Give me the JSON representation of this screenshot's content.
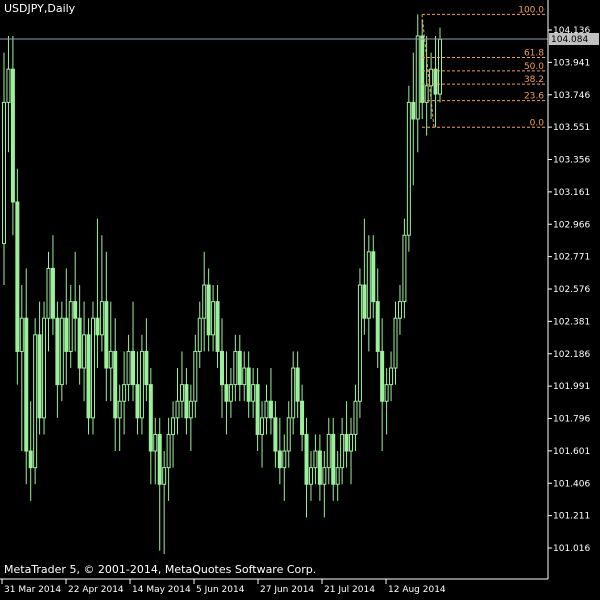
{
  "window": {
    "symbol_label": "USDJPY,Daily",
    "copyright": "MetaTrader 5, © 2001-2014, MetaQuotes Software Corp."
  },
  "price_axis": {
    "ticks": [
      "104.136",
      "103.941",
      "103.746",
      "103.551",
      "103.356",
      "103.161",
      "102.966",
      "102.771",
      "102.576",
      "102.381",
      "102.186",
      "101.991",
      "101.796",
      "101.601",
      "101.406",
      "101.211",
      "101.016"
    ],
    "current_price": "104.084"
  },
  "time_axis": {
    "labels": [
      "31 Mar 2014",
      "22 Apr 2014",
      "14 May 2014",
      "5 Jun 2014",
      "27 Jun 2014",
      "21 Jul 2014",
      "12 Aug 2014"
    ]
  },
  "fibonacci": {
    "levels": [
      "100.0",
      "61.8",
      "50.0",
      "38.2",
      "23.6",
      "0.0"
    ]
  },
  "colors": {
    "background": "#000000",
    "candle": "#9cf09c",
    "grid_line": "#ffffff",
    "fibo": "#f0a050",
    "current_price_line": "#8aa0b8",
    "current_price_badge": "#c0c0c0"
  },
  "chart_data": {
    "type": "candlestick",
    "symbol": "USDJPY",
    "timeframe": "Daily",
    "ylim": [
      101.016,
      104.136
    ],
    "y_ticks": [
      104.136,
      103.941,
      103.746,
      103.551,
      103.356,
      103.161,
      102.966,
      102.771,
      102.576,
      102.381,
      102.186,
      101.991,
      101.796,
      101.601,
      101.406,
      101.211,
      101.016
    ],
    "x_ticks": [
      "31 Mar 2014",
      "22 Apr 2014",
      "14 May 2014",
      "5 Jun 2014",
      "27 Jun 2014",
      "21 Jul 2014",
      "12 Aug 2014"
    ],
    "current_price": 104.084,
    "fibonacci_retracement": {
      "levels": [
        100.0,
        61.8,
        50.0,
        38.2,
        23.6,
        0.0
      ],
      "high_price": 104.23,
      "low_price": 103.55
    },
    "ohlc": [
      [
        102.85,
        104.0,
        102.6,
        103.7
      ],
      [
        103.7,
        104.1,
        103.4,
        103.9
      ],
      [
        103.9,
        104.1,
        102.9,
        103.1
      ],
      [
        103.1,
        103.3,
        102.0,
        102.2
      ],
      [
        102.2,
        102.6,
        101.6,
        102.4
      ],
      [
        102.4,
        102.7,
        101.4,
        101.6
      ],
      [
        101.6,
        101.9,
        101.3,
        101.5
      ],
      [
        101.5,
        102.4,
        101.4,
        102.3
      ],
      [
        102.3,
        102.5,
        101.7,
        101.8
      ],
      [
        101.8,
        102.5,
        101.7,
        102.4
      ],
      [
        102.4,
        102.8,
        102.2,
        102.7
      ],
      [
        102.7,
        102.9,
        102.3,
        102.4
      ],
      [
        102.4,
        102.5,
        101.8,
        102.0
      ],
      [
        102.0,
        102.5,
        101.9,
        102.4
      ],
      [
        102.4,
        102.7,
        102.0,
        102.2
      ],
      [
        102.2,
        102.6,
        102.1,
        102.5
      ],
      [
        102.5,
        102.8,
        102.2,
        102.4
      ],
      [
        102.4,
        102.6,
        102.0,
        102.1
      ],
      [
        102.1,
        102.5,
        101.9,
        102.3
      ],
      [
        102.3,
        102.4,
        101.7,
        101.8
      ],
      [
        101.8,
        102.5,
        101.7,
        102.4
      ],
      [
        102.4,
        103.0,
        102.1,
        102.3
      ],
      [
        102.3,
        102.9,
        102.2,
        102.5
      ],
      [
        102.5,
        102.8,
        101.9,
        102.1
      ],
      [
        102.1,
        102.5,
        101.9,
        102.2
      ],
      [
        102.2,
        102.4,
        101.6,
        101.8
      ],
      [
        101.8,
        102.0,
        101.6,
        101.9
      ],
      [
        101.9,
        102.2,
        101.7,
        102.0
      ],
      [
        102.0,
        102.3,
        101.9,
        102.2
      ],
      [
        102.2,
        102.5,
        101.9,
        102.0
      ],
      [
        102.0,
        102.2,
        101.7,
        101.8
      ],
      [
        101.8,
        102.3,
        101.7,
        102.2
      ],
      [
        102.2,
        102.4,
        101.9,
        102.0
      ],
      [
        102.0,
        102.1,
        101.4,
        101.6
      ],
      [
        101.6,
        101.8,
        101.4,
        101.7
      ],
      [
        101.7,
        101.8,
        101.0,
        101.4
      ],
      [
        101.4,
        101.6,
        100.98,
        101.5
      ],
      [
        101.5,
        101.8,
        101.3,
        101.7
      ],
      [
        101.7,
        101.9,
        101.5,
        101.8
      ],
      [
        101.8,
        102.1,
        101.7,
        101.9
      ],
      [
        101.9,
        102.2,
        101.8,
        102.0
      ],
      [
        102.0,
        102.1,
        101.7,
        101.8
      ],
      [
        101.8,
        102.0,
        101.6,
        101.9
      ],
      [
        101.9,
        102.3,
        101.8,
        102.2
      ],
      [
        102.2,
        102.5,
        102.1,
        102.4
      ],
      [
        102.4,
        102.8,
        102.2,
        102.6
      ],
      [
        102.6,
        102.7,
        102.2,
        102.3
      ],
      [
        102.3,
        102.6,
        102.2,
        102.5
      ],
      [
        102.5,
        102.6,
        102.1,
        102.2
      ],
      [
        102.2,
        102.4,
        101.8,
        102.0
      ],
      [
        102.0,
        102.2,
        101.7,
        101.9
      ],
      [
        101.9,
        102.1,
        101.8,
        102.0
      ],
      [
        102.0,
        102.3,
        101.9,
        102.2
      ],
      [
        102.2,
        102.3,
        101.9,
        102.0
      ],
      [
        102.0,
        102.2,
        101.9,
        102.1
      ],
      [
        102.1,
        102.2,
        101.8,
        101.9
      ],
      [
        101.9,
        102.1,
        101.8,
        102.0
      ],
      [
        102.0,
        102.1,
        101.6,
        101.7
      ],
      [
        101.7,
        101.9,
        101.5,
        101.8
      ],
      [
        101.8,
        102.0,
        101.7,
        101.9
      ],
      [
        101.9,
        102.1,
        101.7,
        101.8
      ],
      [
        101.8,
        101.9,
        101.5,
        101.6
      ],
      [
        101.6,
        101.8,
        101.4,
        101.5
      ],
      [
        101.5,
        101.7,
        101.3,
        101.6
      ],
      [
        101.6,
        101.9,
        101.5,
        101.8
      ],
      [
        101.8,
        102.2,
        101.7,
        102.1
      ],
      [
        102.1,
        102.2,
        101.8,
        101.9
      ],
      [
        101.9,
        102.0,
        101.6,
        101.7
      ],
      [
        101.7,
        101.8,
        101.2,
        101.4
      ],
      [
        101.4,
        101.6,
        101.3,
        101.5
      ],
      [
        101.5,
        101.7,
        101.4,
        101.6
      ],
      [
        101.6,
        101.7,
        101.3,
        101.4
      ],
      [
        101.4,
        101.6,
        101.2,
        101.5
      ],
      [
        101.5,
        101.8,
        101.4,
        101.7
      ],
      [
        101.7,
        101.8,
        101.3,
        101.4
      ],
      [
        101.4,
        101.6,
        101.3,
        101.5
      ],
      [
        101.5,
        101.8,
        101.4,
        101.7
      ],
      [
        101.7,
        101.9,
        101.5,
        101.6
      ],
      [
        101.6,
        101.8,
        101.4,
        101.7
      ],
      [
        101.7,
        102.0,
        101.6,
        101.9
      ],
      [
        101.9,
        102.7,
        101.8,
        102.6
      ],
      [
        102.6,
        103.0,
        102.3,
        102.4
      ],
      [
        102.4,
        102.9,
        102.2,
        102.8
      ],
      [
        102.8,
        102.9,
        102.4,
        102.5
      ],
      [
        102.5,
        102.7,
        102.1,
        102.2
      ],
      [
        102.2,
        102.4,
        101.6,
        101.9
      ],
      [
        101.9,
        102.1,
        101.7,
        102.0
      ],
      [
        102.0,
        102.2,
        101.9,
        102.1
      ],
      [
        102.1,
        102.5,
        102.0,
        102.4
      ],
      [
        102.4,
        102.6,
        102.3,
        102.5
      ],
      [
        102.5,
        103.0,
        102.4,
        102.9
      ],
      [
        102.9,
        103.8,
        102.8,
        103.7
      ],
      [
        103.7,
        104.0,
        103.2,
        103.6
      ],
      [
        103.6,
        104.23,
        103.4,
        104.1
      ],
      [
        104.1,
        104.2,
        103.6,
        103.7
      ],
      [
        103.7,
        104.1,
        103.5,
        103.8
      ],
      [
        103.8,
        104.0,
        103.6,
        103.9
      ],
      [
        103.9,
        104.1,
        103.55,
        103.75
      ],
      [
        103.75,
        104.15,
        103.7,
        104.08
      ]
    ]
  }
}
